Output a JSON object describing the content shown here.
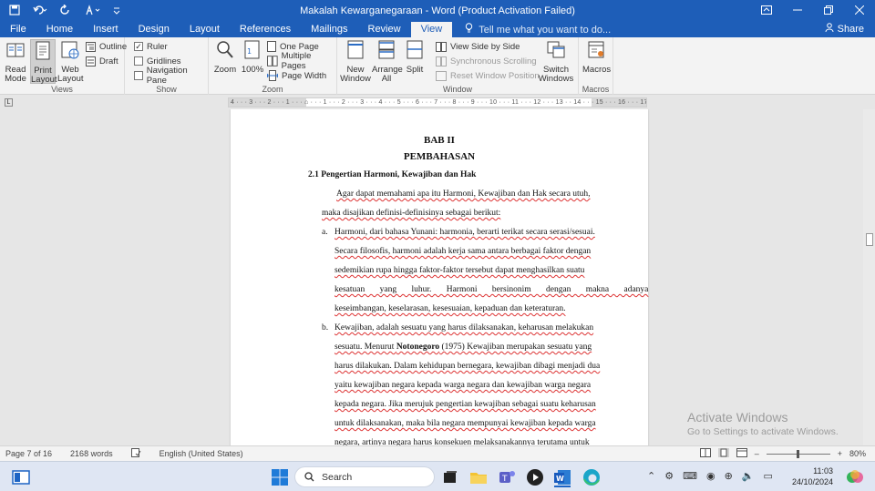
{
  "titlebar": {
    "title": "Makalah Kewarganegaraan - Word (Product Activation Failed)",
    "quick_access": [
      "save-icon",
      "undo-icon",
      "redo-icon",
      "touch-mode-icon",
      "customize-icon"
    ],
    "window_buttons": [
      "ribbon-display-icon",
      "minimize-icon",
      "restore-icon",
      "close-icon"
    ]
  },
  "tabs": [
    "File",
    "Home",
    "Insert",
    "Design",
    "Layout",
    "References",
    "Mailings",
    "Review",
    "View"
  ],
  "active_tab": "View",
  "tellme_placeholder": "Tell me what you want to do...",
  "share_label": "Share",
  "ribbon": {
    "views": {
      "label": "Views",
      "read_mode": "Read Mode",
      "print_layout": "Print Layout",
      "web_layout": "Web Layout",
      "outline": "Outline",
      "draft": "Draft"
    },
    "show": {
      "label": "Show",
      "ruler": "Ruler",
      "gridlines": "Gridlines",
      "navigation_pane": "Navigation Pane",
      "ruler_checked": true
    },
    "zoom": {
      "label": "Zoom",
      "zoom": "Zoom",
      "hundred": "100%",
      "one_page": "One Page",
      "multiple_pages": "Multiple Pages",
      "page_width": "Page Width"
    },
    "window": {
      "label": "Window",
      "new_window": "New Window",
      "arrange_all": "Arrange All",
      "split": "Split",
      "side_by_side": "View Side by Side",
      "sync_scrolling": "Synchronous Scrolling",
      "reset_position": "Reset Window Position",
      "switch_windows": "Switch Windows"
    },
    "macros": {
      "label": "Macros",
      "macros": "Macros"
    }
  },
  "ruler_text": "4 · · · 3 · · · 2 · · · 1 · · · ⌂ · · · 1 · · · 2 · · · 3 · · · 4 · · · 5 · · · 6 · · · 7 · · · 8 · · · 9 · · · 10 · · · 11 · · · 12 · · · 13 · · 14 · · · 15 · · · 16 · · · 17",
  "document": {
    "heading1": "BAB II",
    "heading2": "PEMBAHASAN",
    "section": "2.1  Pengertian Harmoni, Kewajiban dan Hak",
    "intro1": "Agar dapat memahami apa itu Harmoni, Kewajiban dan Hak secara utuh,",
    "intro2": "maka disajikan definisi-definisinya sebagai berikut:",
    "a_marker": "a.",
    "a1": "Harmoni, dari bahasa Yunani: harmonia, berarti terikat secara serasi/sesuai.",
    "a2": "Secara filosofis, harmoni adalah kerja sama antara berbagai faktor dengan",
    "a3": "sedemikian rupa hingga faktor-faktor tersebut dapat menghasilkan suatu",
    "a4": "kesatuan yang luhur. Harmoni bersinonim dengan makna adanya",
    "a5": "keseimbangan, keselarasan, kesesuaian, kepaduan dan keteraturan.",
    "b_marker": "b.",
    "b1": "Kewajiban, adalah sesuatu yang harus dilaksanakan, keharusan melakukan",
    "b2_pre": "sesuatu. Menurut ",
    "b2_bold": "Notonegoro",
    "b2_post": " (1975) Kewajiban merupakan sesuatu yang",
    "b3": "harus dilakukan. Dalam kehidupan bernegara, kewajiban dibagi menjadi dua",
    "b4": "yaitu kewajiban negara kepada warga negara dan kewajiban warga negara",
    "b5": "kepada negara. Jika merujuk pengertian kewajiban sebagai suatu keharusan",
    "b6": "untuk dilaksanakan, maka bila negara mempunyai kewajiban kepada warga",
    "b7": "negara, artinya negara harus konsekuen melaksanakannya terutama untuk"
  },
  "watermark": {
    "line1": "Activate Windows",
    "line2": "Go to Settings to activate Windows."
  },
  "status": {
    "page": "Page 7 of 16",
    "words": "2168 words",
    "language": "English (United States)",
    "zoom": "80%"
  },
  "taskbar": {
    "search_placeholder": "Search",
    "time": "11:03",
    "date": "24/10/2024"
  }
}
